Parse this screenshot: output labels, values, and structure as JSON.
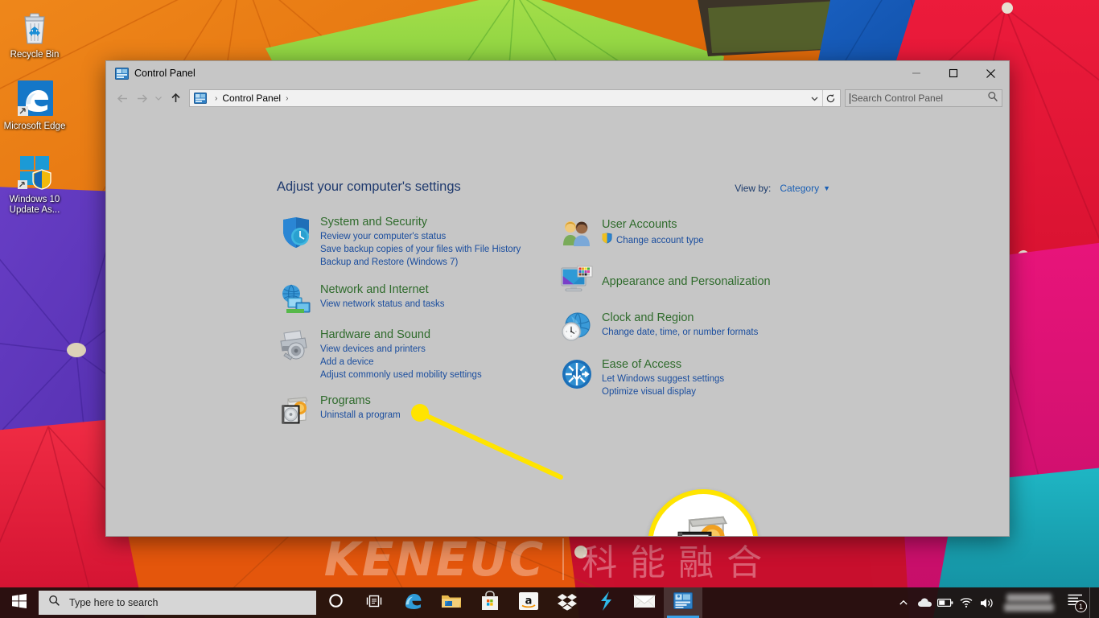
{
  "desktop": {
    "icons": [
      {
        "name": "recycle-bin",
        "label": "Recycle Bin"
      },
      {
        "name": "microsoft-edge",
        "label": "Microsoft Edge"
      },
      {
        "name": "windows-10-update-assistant",
        "label": "Windows 10 Update As..."
      }
    ],
    "watermark": {
      "english": "KENEUC",
      "chinese": "科能融合"
    }
  },
  "window": {
    "title": "Control Panel",
    "icon": "control-panel-icon",
    "controls": {
      "minimize": "—",
      "maximize": "☐",
      "close": "✕"
    },
    "nav": {
      "back": "←",
      "forward": "→",
      "recent": "∨",
      "up": "↑",
      "history_dropdown": "∨",
      "refresh": "↻"
    },
    "breadcrumb": {
      "items": [
        "Control Panel"
      ],
      "separator": "›",
      "trailing_separator": "›"
    },
    "search": {
      "placeholder": "Search Control Panel",
      "value": "",
      "icon": "search-icon"
    }
  },
  "content": {
    "heading": "Adjust your computer's settings",
    "view_by": {
      "label": "View by:",
      "value": "Category",
      "chevron": "▾"
    },
    "left_column": [
      {
        "id": "system-and-security",
        "icon": "shield-icon",
        "title": "System and Security",
        "links": [
          "Review your computer's status",
          "Save backup copies of your files with File History",
          "Backup and Restore (Windows 7)"
        ]
      },
      {
        "id": "network-and-internet",
        "icon": "network-globe-icon",
        "title": "Network and Internet",
        "links": [
          "View network status and tasks"
        ]
      },
      {
        "id": "hardware-and-sound",
        "icon": "printer-icon",
        "title": "Hardware and Sound",
        "links": [
          "View devices and printers",
          "Add a device",
          "Adjust commonly used mobility settings"
        ]
      },
      {
        "id": "programs",
        "icon": "programs-cd-icon",
        "title": "Programs",
        "links": [
          "Uninstall a program"
        ]
      }
    ],
    "right_column": [
      {
        "id": "user-accounts",
        "icon": "users-icon",
        "title": "User Accounts",
        "links": [
          "Change account type"
        ],
        "shield_on_first_link": true
      },
      {
        "id": "appearance-and-personalization",
        "icon": "monitor-palette-icon",
        "title": "Appearance and Personalization",
        "links": []
      },
      {
        "id": "clock-and-region",
        "icon": "clock-globe-icon",
        "title": "Clock and Region",
        "links": [
          "Change date, time, or number formats"
        ]
      },
      {
        "id": "ease-of-access",
        "icon": "ease-of-access-icon",
        "title": "Ease of Access",
        "links": [
          "Let Windows suggest settings",
          "Optimize visual display"
        ]
      }
    ],
    "callout": {
      "target": "programs-cd-icon",
      "color": "#ffe400",
      "magnified_icon": "programs-cd-icon"
    }
  },
  "taskbar": {
    "start": {
      "name": "start-button",
      "icon": "windows-logo-icon"
    },
    "search": {
      "placeholder": "Type here to search",
      "icon": "search-icon"
    },
    "cortana": {
      "name": "cortana-button",
      "icon": "cortana-circle-icon"
    },
    "task_view": {
      "name": "task-view-button",
      "icon": "task-view-icon"
    },
    "pinned": [
      {
        "name": "edge",
        "icon": "edge-icon",
        "active": false
      },
      {
        "name": "file-explorer",
        "icon": "folder-icon",
        "active": false
      },
      {
        "name": "microsoft-store",
        "icon": "store-bag-icon",
        "active": false
      },
      {
        "name": "amazon",
        "icon": "amazon-icon",
        "active": false
      },
      {
        "name": "dropbox",
        "icon": "dropbox-icon",
        "active": false
      },
      {
        "name": "lightning-app",
        "icon": "lightning-bolt-icon",
        "active": false
      },
      {
        "name": "mail",
        "icon": "envelope-icon",
        "active": false
      },
      {
        "name": "control-panel",
        "icon": "control-panel-icon",
        "active": true
      }
    ],
    "tray": {
      "overflow": "∧",
      "icons": [
        "onedrive-cloud-icon",
        "battery-icon",
        "wifi-icon",
        "volume-icon"
      ],
      "clock": "",
      "notifications": {
        "icon": "action-center-icon",
        "badge": "1"
      }
    }
  },
  "colors": {
    "window_bg": "#c6c6c6",
    "category_title": "#2f6b2c",
    "category_link": "#1a4d9e",
    "heading": "#1f3a6e",
    "callout": "#ffe400",
    "taskbar": "#1e100e",
    "accent": "#38a0e8"
  }
}
